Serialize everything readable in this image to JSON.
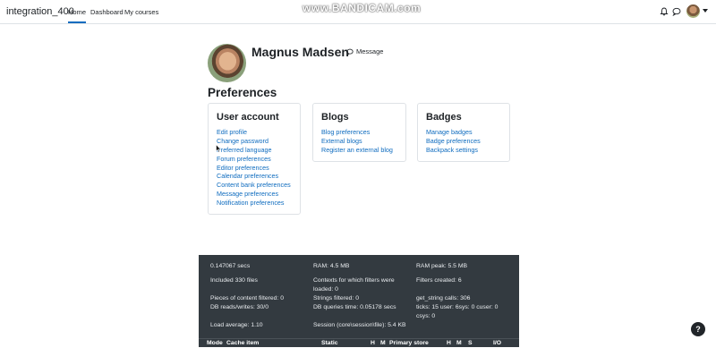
{
  "navbar": {
    "site_name": "integration_400",
    "links": [
      "Home",
      "Dashboard",
      "My courses"
    ],
    "watermark": "www.BANDICAM.com"
  },
  "profile": {
    "name": "Magnus Madsen",
    "message_label": "Message"
  },
  "page_title": "Preferences",
  "cards": {
    "user_account": {
      "title": "User account",
      "links": [
        "Edit profile",
        "Change password",
        "Preferred language",
        "Forum preferences",
        "Editor preferences",
        "Calendar preferences",
        "Content bank preferences",
        "Message preferences",
        "Notification preferences"
      ]
    },
    "blogs": {
      "title": "Blogs",
      "links": [
        "Blog preferences",
        "External blogs",
        "Register an external blog"
      ]
    },
    "badges": {
      "title": "Badges",
      "links": [
        "Manage badges",
        "Badge preferences",
        "Backpack settings"
      ]
    }
  },
  "footer": {
    "time": "0.147067 secs",
    "ram": "RAM: 4.5 MB",
    "ram_peak": "RAM peak: 5.5 MB",
    "included": "Included 330 files",
    "contexts_1": "Contexts for which filters were",
    "contexts_2": "loaded: 0",
    "filters_created": "Filters created: 6",
    "pieces_filtered": "Pieces of content filtered: 0",
    "strings_filtered": "Strings filtered: 0",
    "get_string": "get_string calls: 306",
    "db_rw": "DB reads/writes: 30/0",
    "db_time": "DB queries time: 0.05178 secs",
    "ticks": "ticks: 15 user: 6sys: 0 cuser: 0",
    "csys": "csys: 0",
    "load_avg": "Load average: 1.10",
    "session": "Session (core\\session\\file): 5.4 KB",
    "cache_headers": [
      "Mode",
      "Cache item",
      "Static",
      "H",
      "M",
      "Primary store",
      "H",
      "M",
      "S",
      "I/O"
    ]
  },
  "help_label": "?",
  "icons": [
    "bell-icon",
    "chat-icon",
    "message-icon",
    "cursor-icon",
    "help-icon"
  ]
}
